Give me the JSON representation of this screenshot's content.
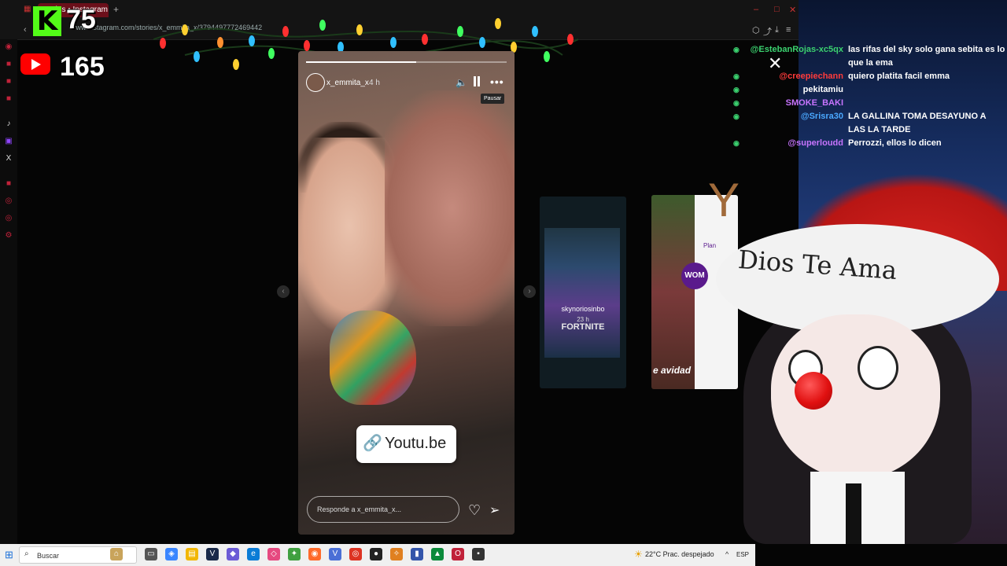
{
  "browser": {
    "tab_title": "stories • Instagram",
    "address": "www.instagram.com/stories/x_emmita_x/3794497772469442",
    "window_controls": [
      "minimize",
      "maximize",
      "close"
    ]
  },
  "overlays": {
    "kick_count": "75",
    "youtube_count": "165"
  },
  "story": {
    "username": "x_emmita_x",
    "time": "4 h",
    "tooltip": "Pausar",
    "link_sticker": "Youtu.be",
    "reply_placeholder": "Responde a x_emmita_x...",
    "progress": 0.55
  },
  "previews": [
    {
      "username": "skynoriosinbo",
      "time": "23 h",
      "title": "FORTNITE"
    },
    {
      "badge": "WOM",
      "plan": "Plan",
      "text": "e avidad"
    }
  ],
  "chat": [
    {
      "name": "@EstebanRojas-xc5qx",
      "msg": "las rifas del sky solo gana sebita es lo que la ema",
      "color": "#3bd16f"
    },
    {
      "name": "@creepiechann",
      "msg": "quiero platita facil emma",
      "color": "#ff3b3b"
    },
    {
      "name": "pekitamiu",
      "msg": "",
      "color": "#ffffff"
    },
    {
      "name": "SMOKE_BAKI",
      "msg": "",
      "color": "#c774ff"
    },
    {
      "name": "@Srisra30",
      "msg": "LA GALLINA TOMA DESAYUNO A LAS LA TARDE",
      "color": "#4aa8ff"
    },
    {
      "name": "@superloudd",
      "msg": "Perrozzi, ellos lo dicen",
      "color": "#c774ff"
    }
  ],
  "avatar": {
    "hat_text": "Dios Te Ama"
  },
  "taskbar": {
    "search_placeholder": "Buscar",
    "weather": "22°C  Prac. despejado",
    "language": "ESP"
  },
  "colors": {
    "accent": "#53fc18",
    "youtube": "#ff0000",
    "instagram_bg": "#000000"
  }
}
